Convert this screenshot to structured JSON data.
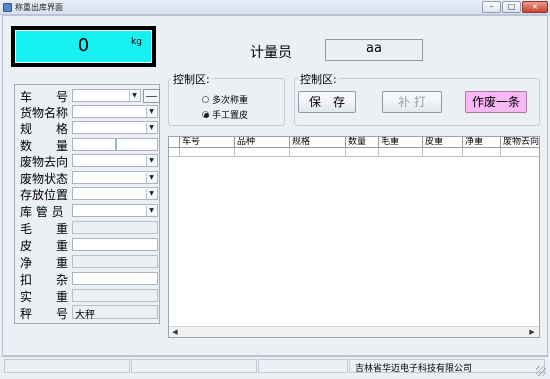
{
  "window": {
    "title": "称重出库界面",
    "controls": {
      "minimize": "–",
      "maximize": "□",
      "close": "×"
    }
  },
  "weight_display": {
    "value": "0",
    "unit": "kg",
    "background_color": "#18f1f1"
  },
  "operator": {
    "label": "计量员",
    "value": "aa"
  },
  "form": {
    "fields": [
      {
        "label": "车　　号",
        "type": "combo",
        "value": ""
      },
      {
        "label": "货物名称",
        "type": "combo",
        "value": ""
      },
      {
        "label": "规　　格",
        "type": "combo",
        "value": ""
      },
      {
        "label": "数　　量",
        "type": "text-split",
        "value": ""
      },
      {
        "label": "废物去向",
        "type": "combo",
        "value": ""
      },
      {
        "label": "废物状态",
        "type": "combo",
        "value": ""
      },
      {
        "label": "存放位置",
        "type": "combo",
        "value": ""
      },
      {
        "label": "库 管 员",
        "type": "combo",
        "value": ""
      },
      {
        "label": "毛　　重",
        "type": "readonly",
        "value": ""
      },
      {
        "label": "皮　　重",
        "type": "text",
        "value": ""
      },
      {
        "label": "净　　重",
        "type": "readonly",
        "value": ""
      },
      {
        "label": "扣　　杂",
        "type": "text",
        "value": ""
      },
      {
        "label": "实　　重",
        "type": "readonly",
        "value": ""
      },
      {
        "label": "秤　　号",
        "type": "readonly",
        "value": "大秤"
      }
    ]
  },
  "control_left": {
    "title": "控制区:",
    "options": [
      {
        "label": "多次称重",
        "checked": false
      },
      {
        "label": "手工置皮",
        "checked": true
      }
    ]
  },
  "control_right": {
    "title": "控制区:",
    "buttons": {
      "save": "保　存",
      "reprint": "补 打",
      "void": "作废一条"
    }
  },
  "table": {
    "columns": [
      "车号",
      "品种",
      "规格",
      "数量",
      "毛重",
      "皮重",
      "净重",
      "废物去向"
    ]
  },
  "statusbar": {
    "company": "吉林省华迈电子科技有限公司"
  }
}
